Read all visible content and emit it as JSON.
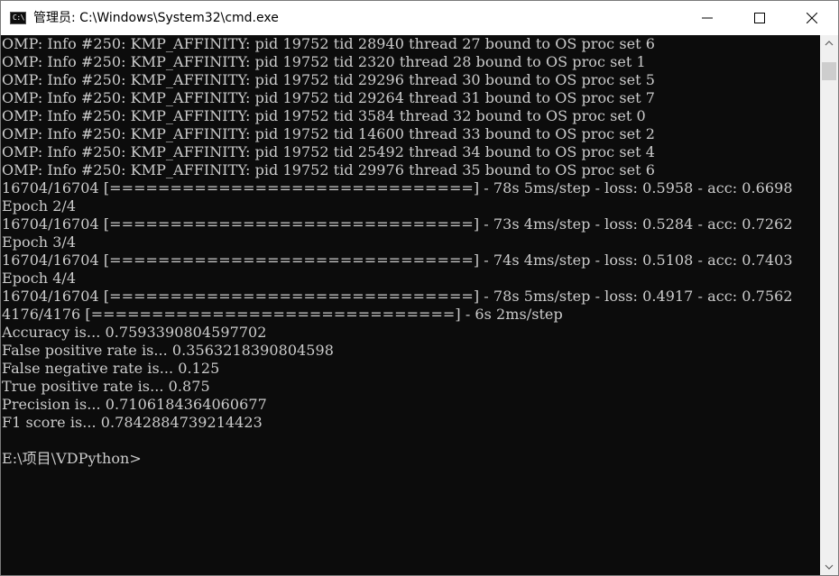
{
  "window": {
    "title": "管理员: C:\\Windows\\System32\\cmd.exe",
    "icon_label": "C:\\",
    "icon": "cmd-icon",
    "controls": {
      "minimize_icon": "minimize-icon",
      "maximize_icon": "maximize-icon",
      "close_icon": "close-icon"
    }
  },
  "console": {
    "lines": [
      "OMP: Info #250: KMP_AFFINITY: pid 19752 tid 28940 thread 27 bound to OS proc set 6",
      "OMP: Info #250: KMP_AFFINITY: pid 19752 tid 2320 thread 28 bound to OS proc set 1",
      "OMP: Info #250: KMP_AFFINITY: pid 19752 tid 29296 thread 30 bound to OS proc set 5",
      "OMP: Info #250: KMP_AFFINITY: pid 19752 tid 29264 thread 31 bound to OS proc set 7",
      "OMP: Info #250: KMP_AFFINITY: pid 19752 tid 3584 thread 32 bound to OS proc set 0",
      "OMP: Info #250: KMP_AFFINITY: pid 19752 tid 14600 thread 33 bound to OS proc set 2",
      "OMP: Info #250: KMP_AFFINITY: pid 19752 tid 25492 thread 34 bound to OS proc set 4",
      "OMP: Info #250: KMP_AFFINITY: pid 19752 tid 29976 thread 35 bound to OS proc set 6",
      "16704/16704 [==============================] - 78s 5ms/step - loss: 0.5958 - acc: 0.6698",
      "Epoch 2/4",
      "16704/16704 [==============================] - 73s 4ms/step - loss: 0.5284 - acc: 0.7262",
      "Epoch 3/4",
      "16704/16704 [==============================] - 74s 4ms/step - loss: 0.5108 - acc: 0.7403",
      "Epoch 4/4",
      "16704/16704 [==============================] - 78s 5ms/step - loss: 0.4917 - acc: 0.7562",
      "4176/4176 [==============================] - 6s 2ms/step",
      "Accuracy is... 0.7593390804597702",
      "False positive rate is... 0.3563218390804598",
      "False negative rate is... 0.125",
      "True positive rate is... 0.875",
      "Precision is... 0.7106184364060677",
      "F1 score is... 0.7842884739214423",
      "",
      "E:\\项目\\VDPython>"
    ]
  },
  "scrollbar": {
    "up_icon": "scroll-up-arrow-icon",
    "down_icon": "scroll-down-arrow-icon"
  },
  "colors": {
    "console_bg": "#0c0c0c",
    "console_text": "#cccccc",
    "titlebar_bg": "#ffffff"
  }
}
